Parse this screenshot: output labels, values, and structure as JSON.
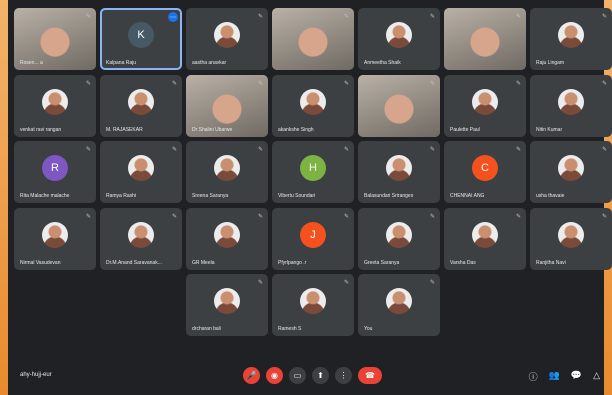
{
  "colors": {
    "background": "#202124",
    "tile": "#3c4043",
    "end_call": "#ea4335",
    "accent": "#1a73e8"
  },
  "participants": [
    {
      "name": "Rosen... a",
      "video": true,
      "mic_muted": false,
      "avatar": "photo"
    },
    {
      "name": "Kalpana Raju",
      "video": false,
      "avatar_letter": "K",
      "avatar_color": "#455a64",
      "active": true
    },
    {
      "name": "aastha anavkar",
      "video": false,
      "avatar": "photo"
    },
    {
      "name": "",
      "video": true
    },
    {
      "name": "Anmeetha Shaik",
      "video": false,
      "avatar": "photo"
    },
    {
      "name": "",
      "video": true
    },
    {
      "name": "Raju Lingam",
      "video": false,
      "avatar": "photo"
    },
    {
      "name": "venkat ravi rangan",
      "video": false,
      "avatar": "photo"
    },
    {
      "name": "M. RAJASEKAR",
      "video": false,
      "avatar": "photo"
    },
    {
      "name": "Dr Shalini Ubarwe",
      "video": true
    },
    {
      "name": "akankshe Singh",
      "video": false,
      "avatar": "photo"
    },
    {
      "name": "",
      "video": true
    },
    {
      "name": "Paulette Paul",
      "video": false,
      "avatar": "photo"
    },
    {
      "name": "Nitin Kumar",
      "video": false,
      "avatar": "photo"
    },
    {
      "name": "Rita Malache malache",
      "video": false,
      "avatar_letter": "R",
      "avatar_color": "#7e57c2"
    },
    {
      "name": "Ramya Rashi",
      "video": false,
      "avatar": "photo"
    },
    {
      "name": "Sreena Saranya",
      "video": false,
      "avatar": "photo"
    },
    {
      "name": "Vibertu Soundari",
      "video": false,
      "avatar_letter": "H",
      "avatar_color": "#7cb342"
    },
    {
      "name": "Balasundari Sriranges",
      "video": false,
      "avatar": "photo"
    },
    {
      "name": "CHENNAI ANG",
      "video": false,
      "avatar_letter": "C",
      "avatar_color": "#f4511e"
    },
    {
      "name": "usha thavaie",
      "video": false,
      "avatar": "photo"
    },
    {
      "name": "Nirmal Vasudevan",
      "video": false,
      "avatar": "photo"
    },
    {
      "name": "Dr.M.Anand Saravanak...",
      "video": false,
      "avatar": "photo"
    },
    {
      "name": "GR Meela",
      "video": false,
      "avatar": "photo"
    },
    {
      "name": "Pfyrlpango .r",
      "video": false,
      "avatar_letter": "J",
      "avatar_color": "#f4511e"
    },
    {
      "name": "Greeta Saranya",
      "video": false,
      "avatar": "photo"
    },
    {
      "name": "Varsha Das",
      "video": false,
      "avatar": "photo"
    },
    {
      "name": "Ranjitha Navi",
      "video": false,
      "avatar": "photo"
    },
    {
      "name": "drcharan bali",
      "video": false,
      "avatar": "photo"
    },
    {
      "name": "Ramesh S",
      "video": false,
      "avatar": "photo"
    },
    {
      "name": "You",
      "video": false,
      "avatar": "photo"
    }
  ],
  "bottom_bar": {
    "meeting_code": "ahy-hujj-eur",
    "controls": [
      "mic-off-icon",
      "camera-off-icon",
      "captions-icon",
      "present-icon",
      "more-icon",
      "end-call-icon"
    ],
    "right_icons": [
      "info-icon",
      "people-icon",
      "chat-icon",
      "activities-icon"
    ]
  }
}
